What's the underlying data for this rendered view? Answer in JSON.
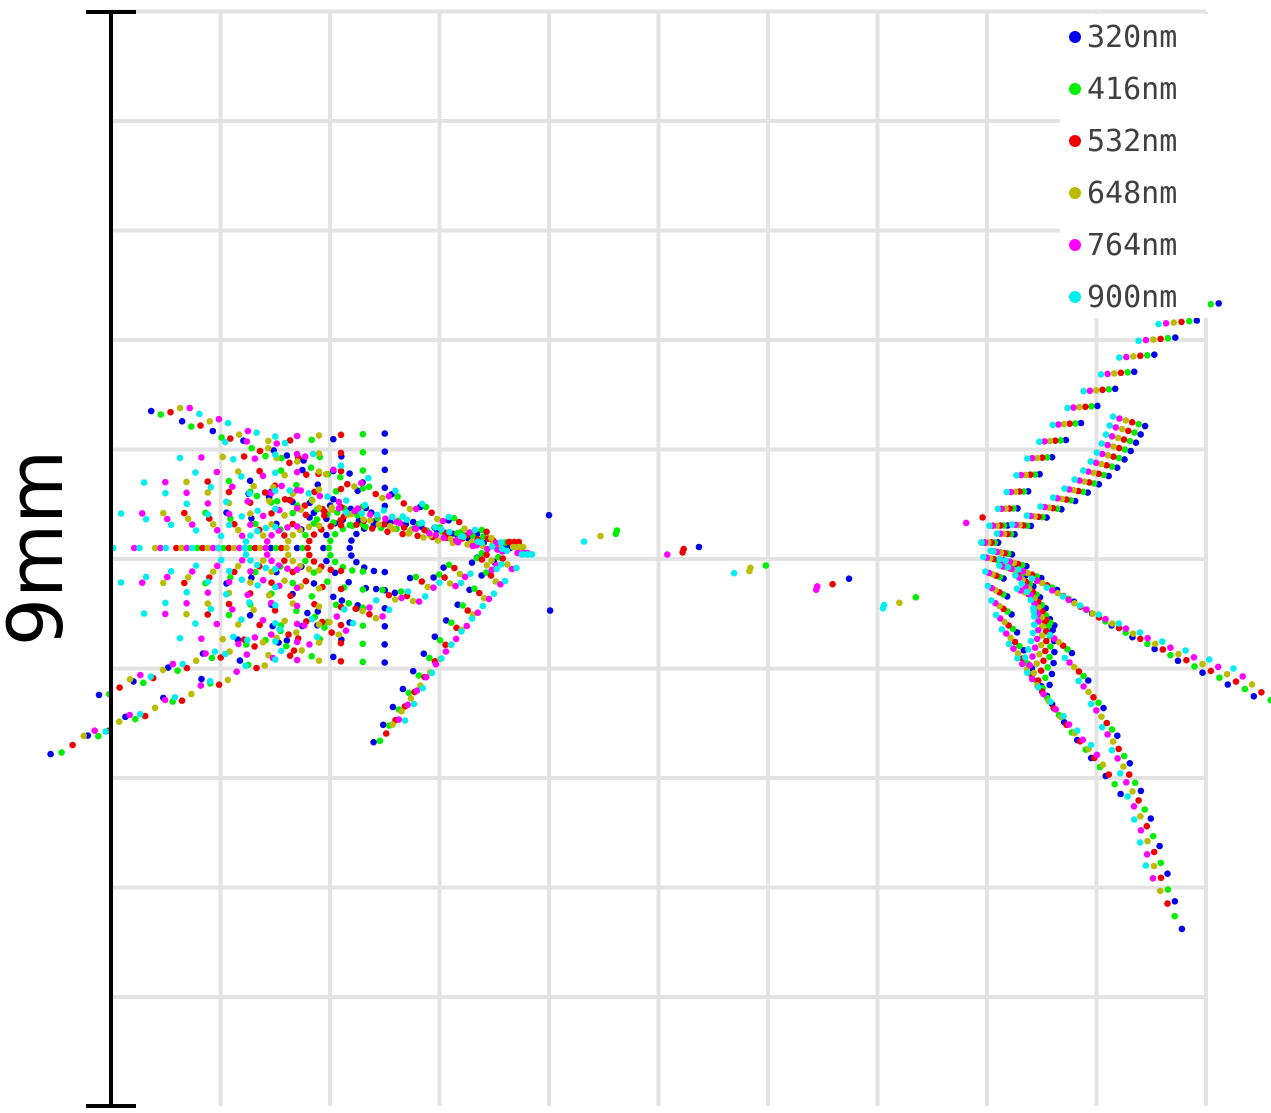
{
  "chart_data": {
    "type": "scatter",
    "title": "",
    "xlabel": "",
    "ylabel": "",
    "scale_bar_label": "9mm",
    "scale_bar_length_mm": 9,
    "xlim": [
      0,
      10.4
    ],
    "ylim": [
      -5,
      5
    ],
    "grid": true,
    "grid_step": 1,
    "legend_position": "top-right",
    "series": [
      {
        "name": "320nm",
        "color": "#0000ee"
      },
      {
        "name": "416nm",
        "color": "#00ee00"
      },
      {
        "name": "532nm",
        "color": "#ee0000"
      },
      {
        "name": "648nm",
        "color": "#bbbb00"
      },
      {
        "name": "764nm",
        "color": "#ff00ff"
      },
      {
        "name": "900nm",
        "color": "#00eeee"
      }
    ],
    "point_groups": {
      "left_fan": {
        "apex": [
          3.6,
          0.1
        ],
        "spokes": [
          [
            0.6,
            1.3
          ],
          [
            0.2,
            -1.1
          ],
          [
            -0.2,
            -1.6
          ],
          [
            2.5,
            -1.5
          ],
          [
            1.4,
            0.6
          ],
          [
            1.9,
            0.4
          ]
        ]
      },
      "right_fan": {
        "apex": [
          8.1,
          0.15
        ],
        "spokes": [
          [
            9.9,
            2.1
          ],
          [
            9.3,
            1.1
          ],
          [
            10.4,
            -1.2
          ],
          [
            9.6,
            -3.0
          ],
          [
            9.1,
            -1.9
          ],
          [
            8.5,
            -1.1
          ]
        ]
      }
    }
  }
}
